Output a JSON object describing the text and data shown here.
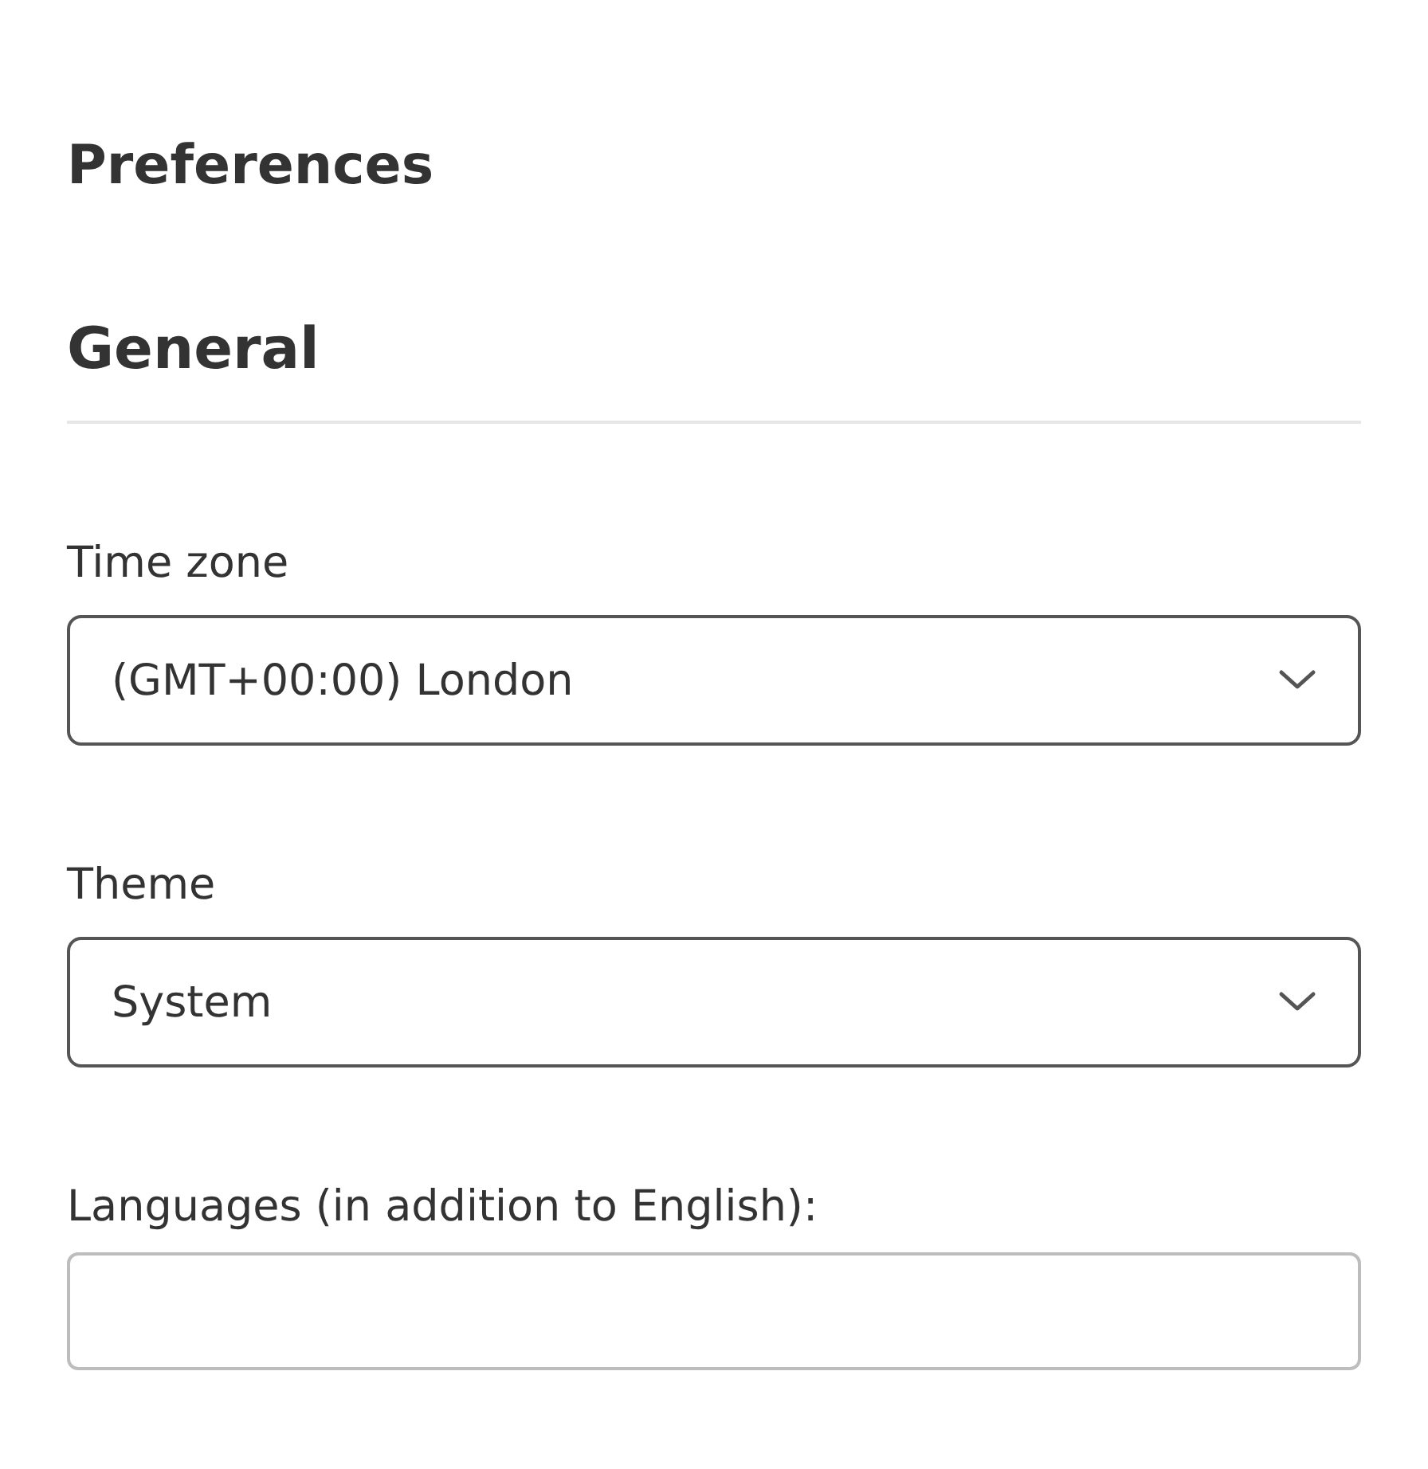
{
  "page": {
    "title": "Preferences"
  },
  "section": {
    "title": "General"
  },
  "fields": [
    {
      "kind": "select",
      "label": "Time zone",
      "value": "(GMT+00:00) London"
    },
    {
      "kind": "select",
      "label": "Theme",
      "value": "System"
    },
    {
      "kind": "text",
      "label": "Languages (in addition to English):"
    }
  ]
}
